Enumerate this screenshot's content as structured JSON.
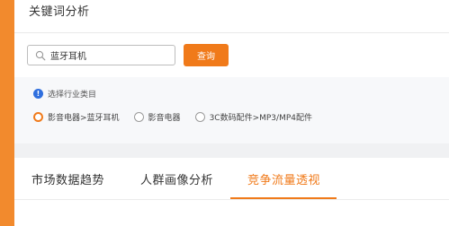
{
  "panel": {
    "title": "关键词分析"
  },
  "search": {
    "value": "蓝牙耳机",
    "placeholder": "",
    "button_label": "查询"
  },
  "filter": {
    "hint": "选择行业类目",
    "options": [
      {
        "label": "影音电器>蓝牙耳机",
        "checked": true
      },
      {
        "label": "影音电器",
        "checked": false
      },
      {
        "label": "3C数码配件>MP3/MP4配件",
        "checked": false
      }
    ]
  },
  "tabs": [
    {
      "label": "市场数据趋势",
      "active": false
    },
    {
      "label": "人群画像分析",
      "active": false
    },
    {
      "label": "竞争流量透视",
      "active": true
    }
  ],
  "colors": {
    "accent": "#f07a1a",
    "info": "#2f6fde",
    "background": "#f0f1f3"
  }
}
